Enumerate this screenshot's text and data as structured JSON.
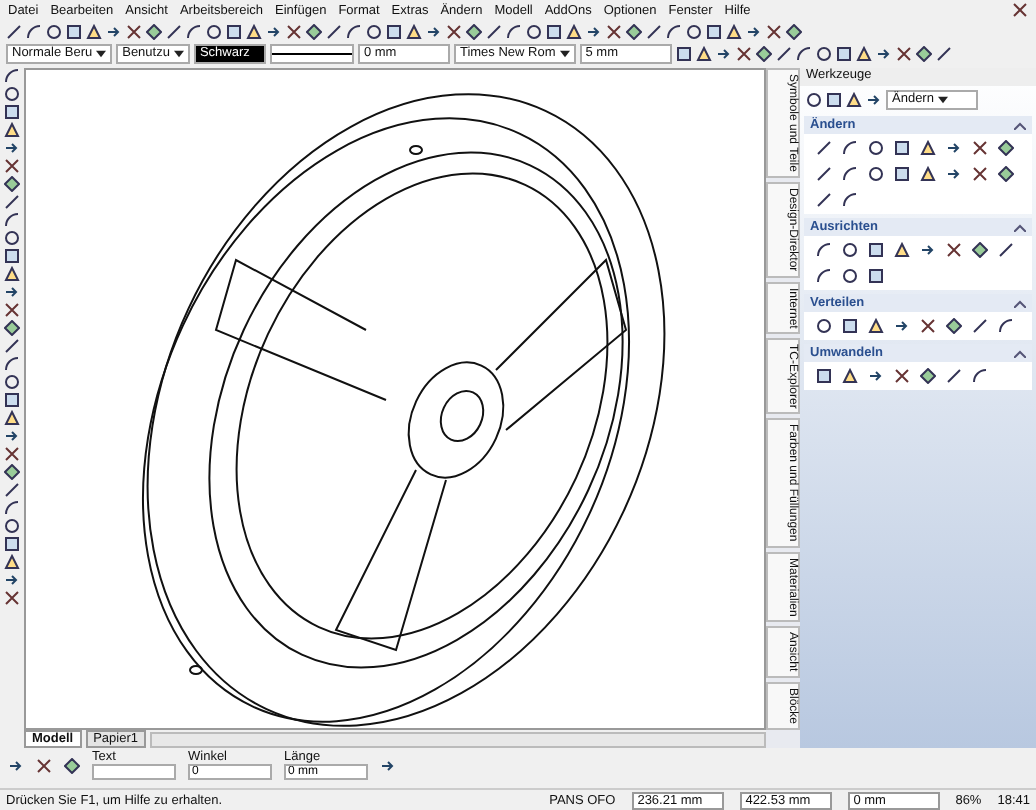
{
  "menu": [
    "Datei",
    "Bearbeiten",
    "Ansicht",
    "Arbeitsbereich",
    "Einfügen",
    "Format",
    "Extras",
    "Ändern",
    "Modell",
    "AddOns",
    "Optionen",
    "Fenster",
    "Hilfe"
  ],
  "property_bar": {
    "style": "Normale Beru",
    "layer": "Benutzu",
    "color_field": "Schwarz",
    "line_width": "0 mm",
    "font": "Times New Rom",
    "font_size": "5 mm"
  },
  "side_tabs": [
    "Symbole und Teile",
    "Design-Direktor",
    "Internet",
    "TC-Explorer",
    "Farben und Füllungen",
    "Materialien",
    "Ansicht",
    "Blöcke"
  ],
  "palette": {
    "title": "Werkzeuge",
    "mode": "Ändern",
    "sections": [
      {
        "title": "Ändern",
        "expanded": true
      },
      {
        "title": "Ausrichten",
        "expanded": true
      },
      {
        "title": "Verteilen",
        "expanded": true
      },
      {
        "title": "Umwandeln",
        "expanded": true
      }
    ]
  },
  "sheet_tabs": [
    {
      "label": "Modell",
      "selected": true
    },
    {
      "label": "Papier1",
      "selected": false
    }
  ],
  "input_bar": [
    {
      "label": "Text"
    },
    {
      "label": "Winkel",
      "value": "0"
    },
    {
      "label": "Länge",
      "value": "0 mm"
    }
  ],
  "status_bar": {
    "message": "Drücken Sie F1, um Hilfe zu erhalten.",
    "modes": "PANS  OFO",
    "x": "236.21 mm",
    "y": "422.53 mm",
    "z": "0 mm",
    "zoom": "86%",
    "time": "18:41"
  }
}
